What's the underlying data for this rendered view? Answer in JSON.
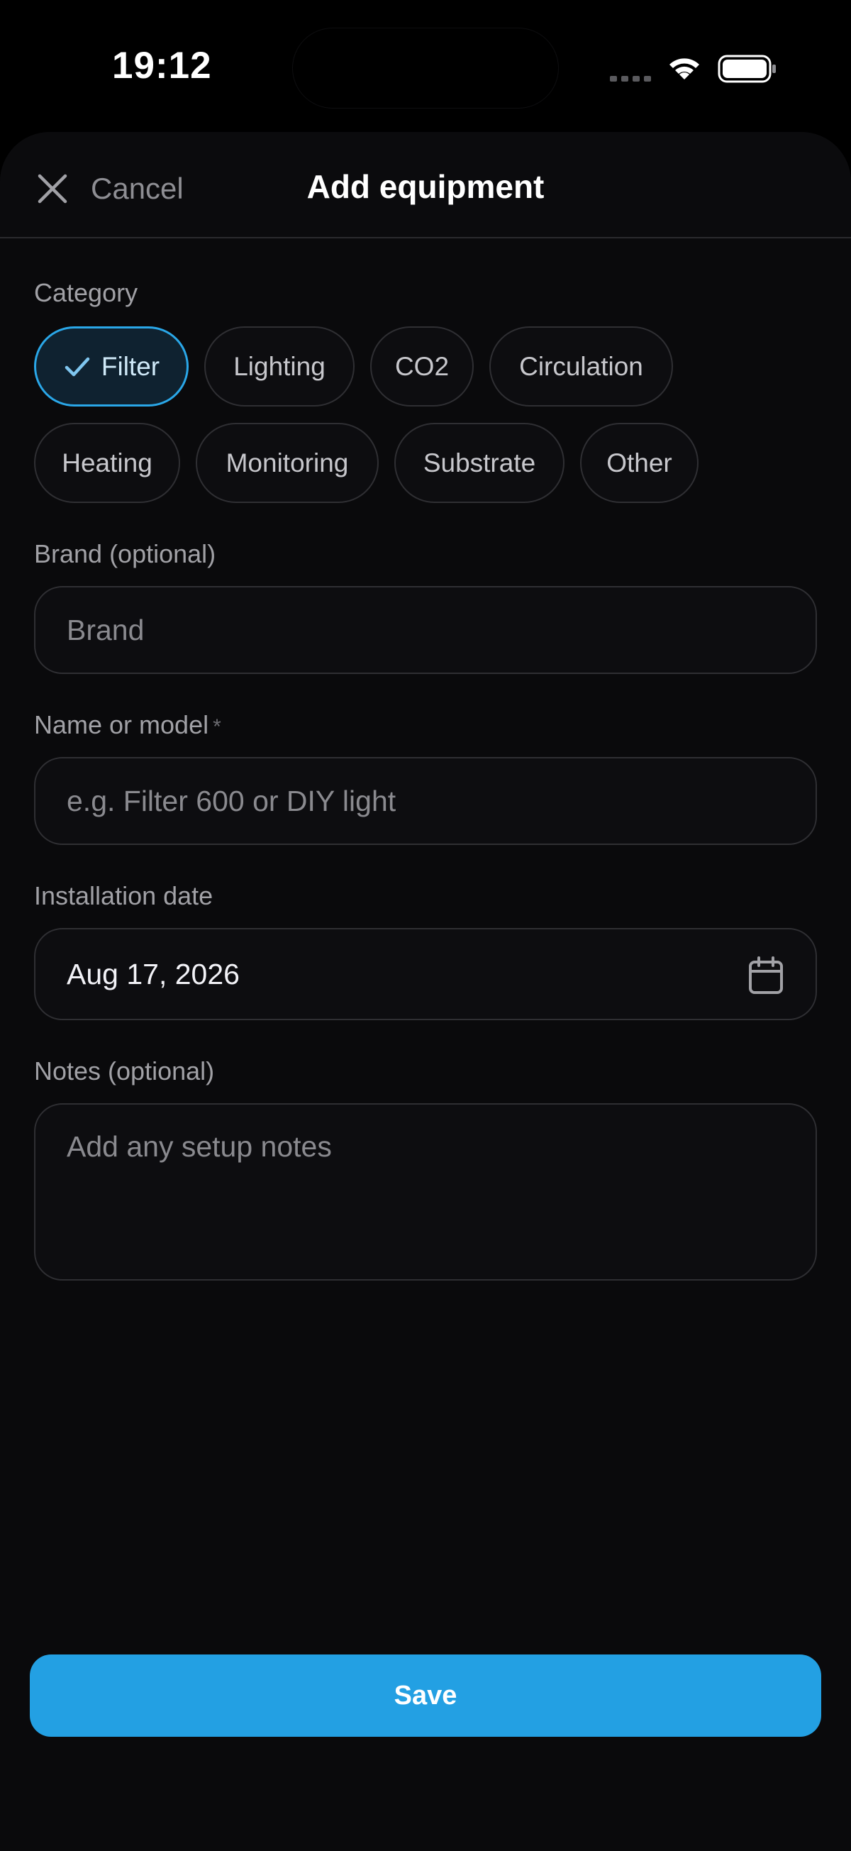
{
  "status_bar": {
    "time": "19:12"
  },
  "header": {
    "cancel_label": "Cancel",
    "title": "Add equipment"
  },
  "category": {
    "label": "Category",
    "selected": "Filter",
    "chips": [
      "Filter",
      "Lighting",
      "CO2",
      "Circulation",
      "Heating",
      "Monitoring",
      "Substrate",
      "Other"
    ]
  },
  "brand": {
    "label": "Brand (optional)",
    "placeholder": "Brand",
    "value": ""
  },
  "name": {
    "label": "Name or model",
    "required_marker": "*",
    "placeholder": "e.g. Filter 600 or DIY light",
    "value": ""
  },
  "installation_date": {
    "label": "Installation date",
    "value": "Aug 17, 2026"
  },
  "notes": {
    "label": "Notes (optional)",
    "placeholder": "Add any setup notes",
    "value": ""
  },
  "save_label": "Save",
  "colors": {
    "accent": "#23a0e3",
    "background": "#0a0a0c",
    "border": "#2f2f33",
    "muted_text": "#a1a1a6"
  }
}
